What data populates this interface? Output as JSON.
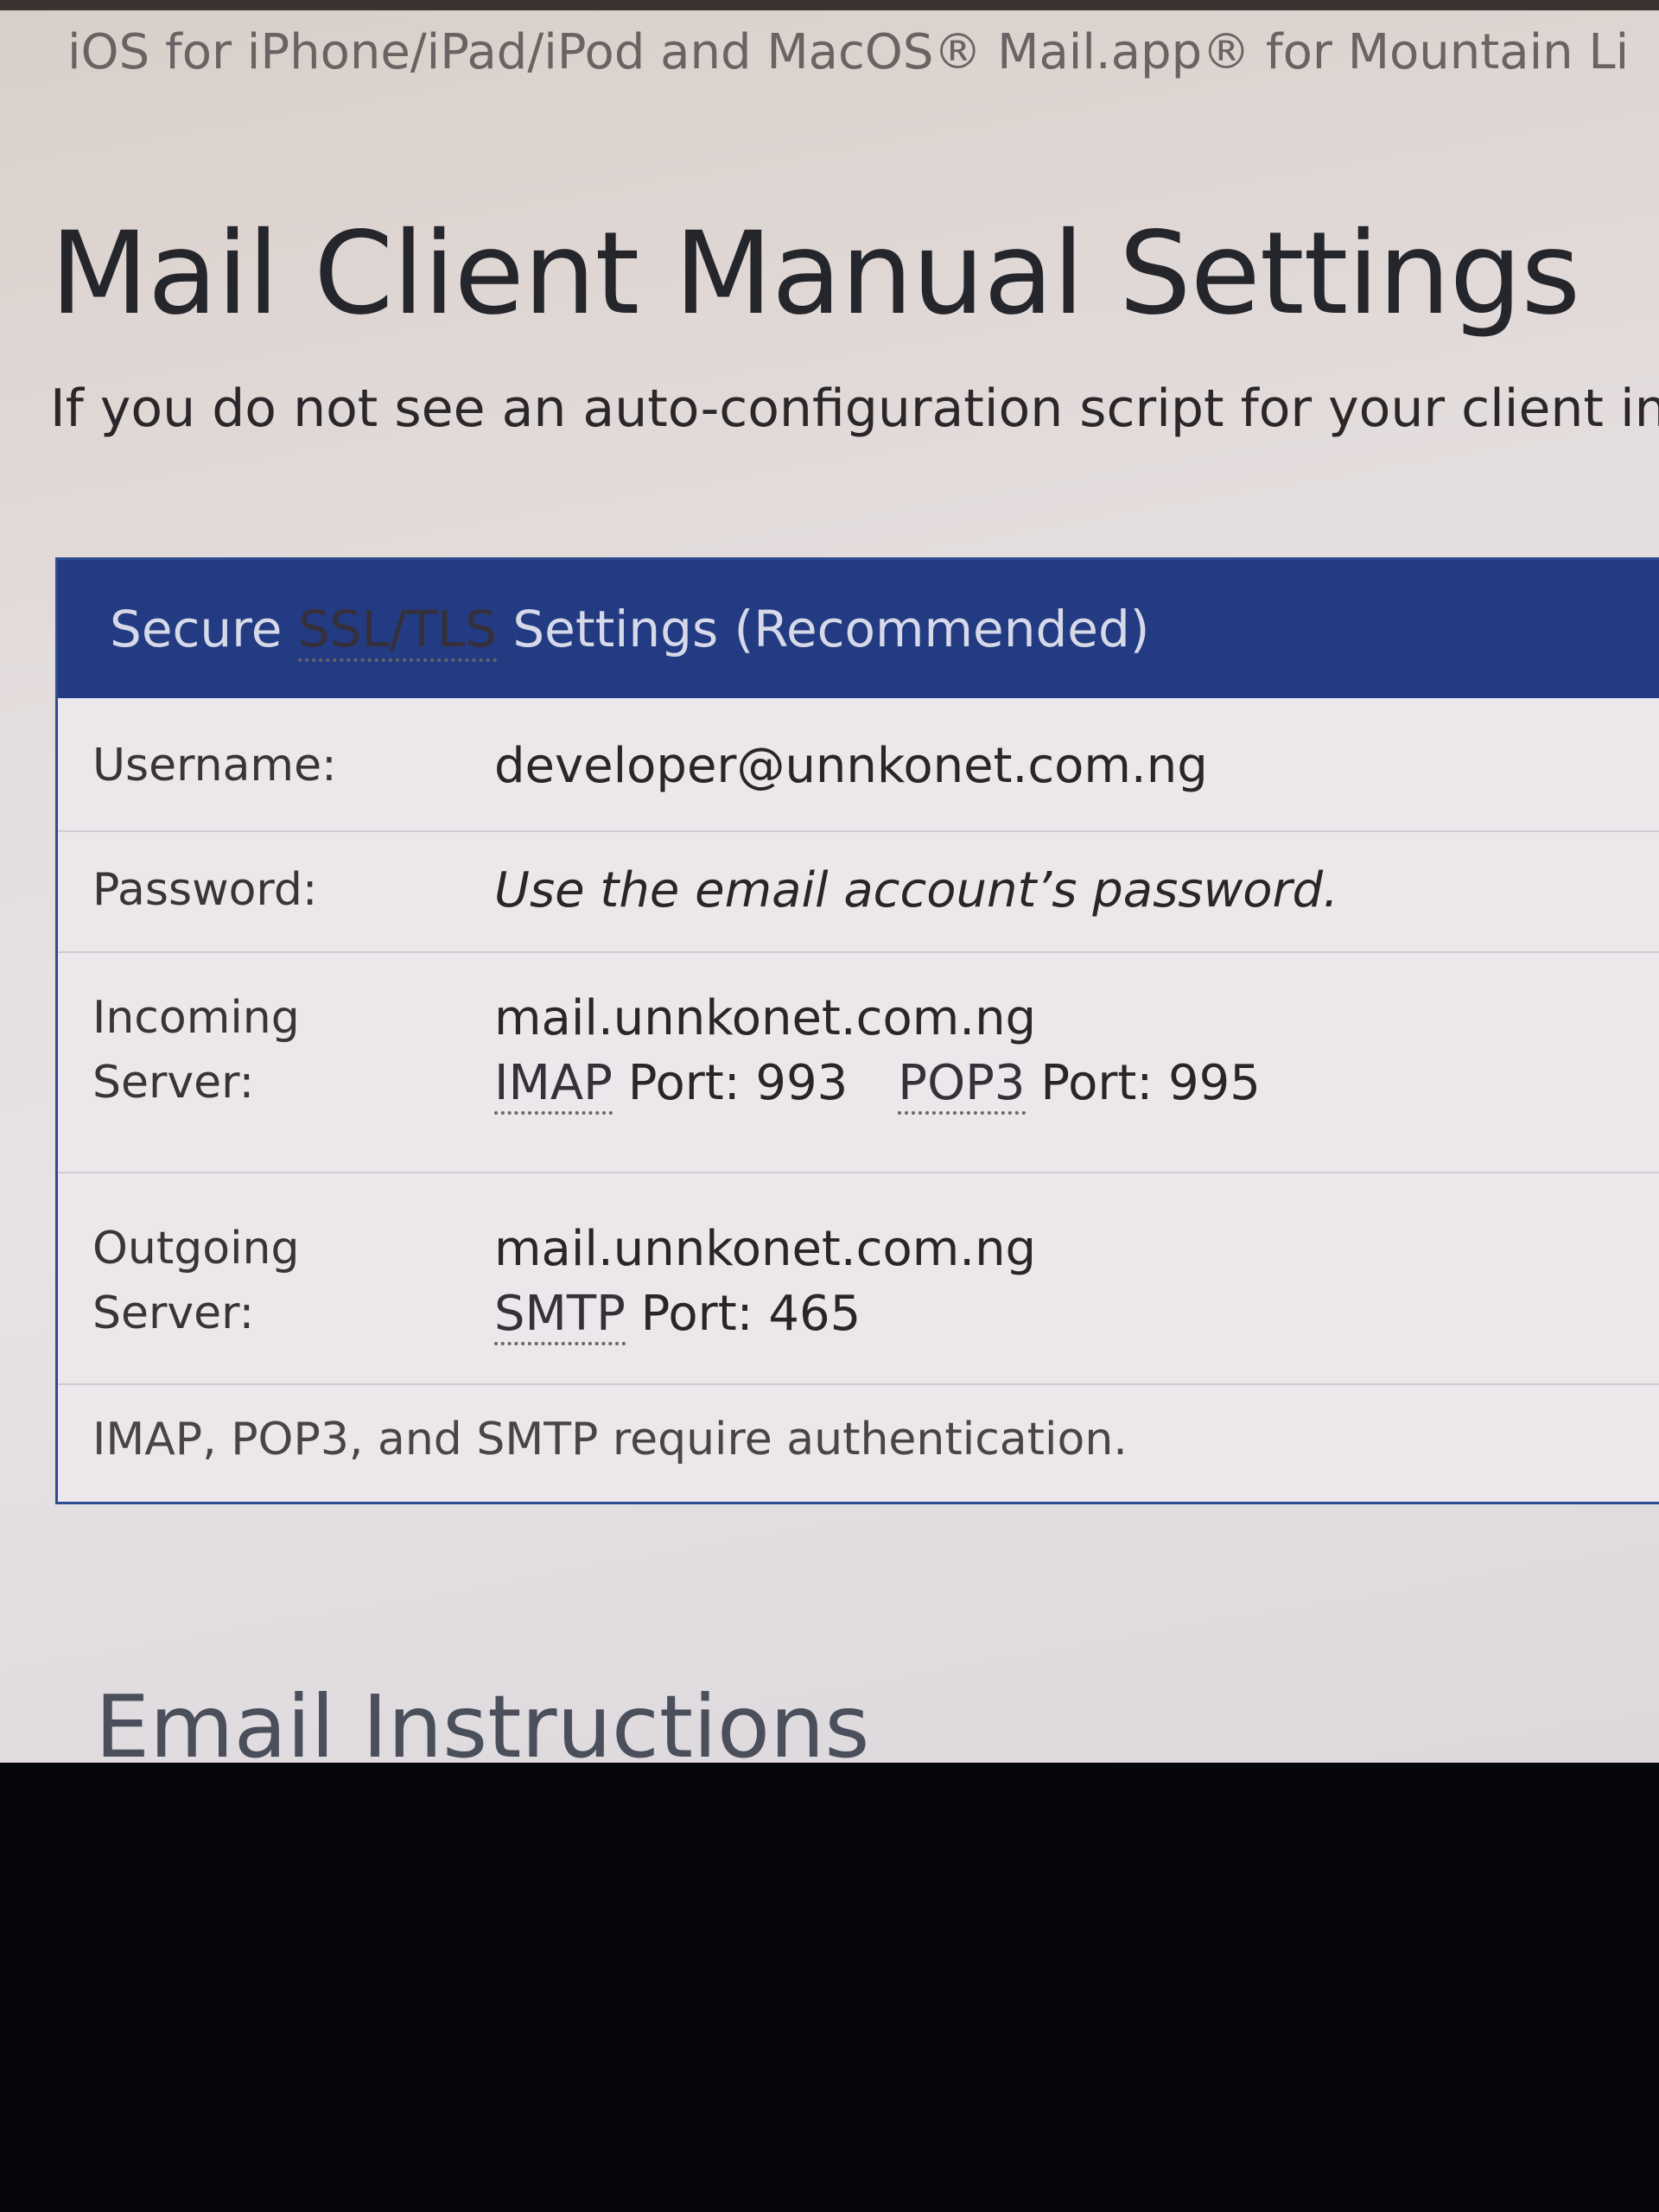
{
  "breadcrumb": "iOS for iPhone/iPad/iPod and MacOS® Mail.app® for Mountain Li",
  "page_title": "Mail Client Manual Settings",
  "intro_text": "If you do not see an auto-configuration script for your client in the lis",
  "panel": {
    "header": {
      "prefix": "Secure ",
      "ssl_tls": "SSL/TLS",
      "suffix": " Settings (Recommended)"
    },
    "username": {
      "label": "Username:",
      "value": "developer@unnkonet.com.ng"
    },
    "password": {
      "label": "Password:",
      "value": "Use the email account’s password."
    },
    "incoming": {
      "label_line1": "Incoming",
      "label_line2": "Server:",
      "host": "mail.unnkonet.com.ng",
      "imap_abbr": "IMAP",
      "imap_port": " Port: 993",
      "pop3_abbr": "POP3",
      "pop3_port": " Port: 995"
    },
    "outgoing": {
      "label_line1": "Outgoing",
      "label_line2": "Server:",
      "host": "mail.unnkonet.com.ng",
      "smtp_abbr": "SMTP",
      "smtp_port": " Port: 465"
    },
    "footnote": "IMAP, POP3, and SMTP require authentication."
  },
  "next_section_heading": "Email Instructions",
  "colors": {
    "panel_header": "#233b82",
    "panel_border": "#2d4c8f",
    "page_background": "#e4dddd"
  }
}
